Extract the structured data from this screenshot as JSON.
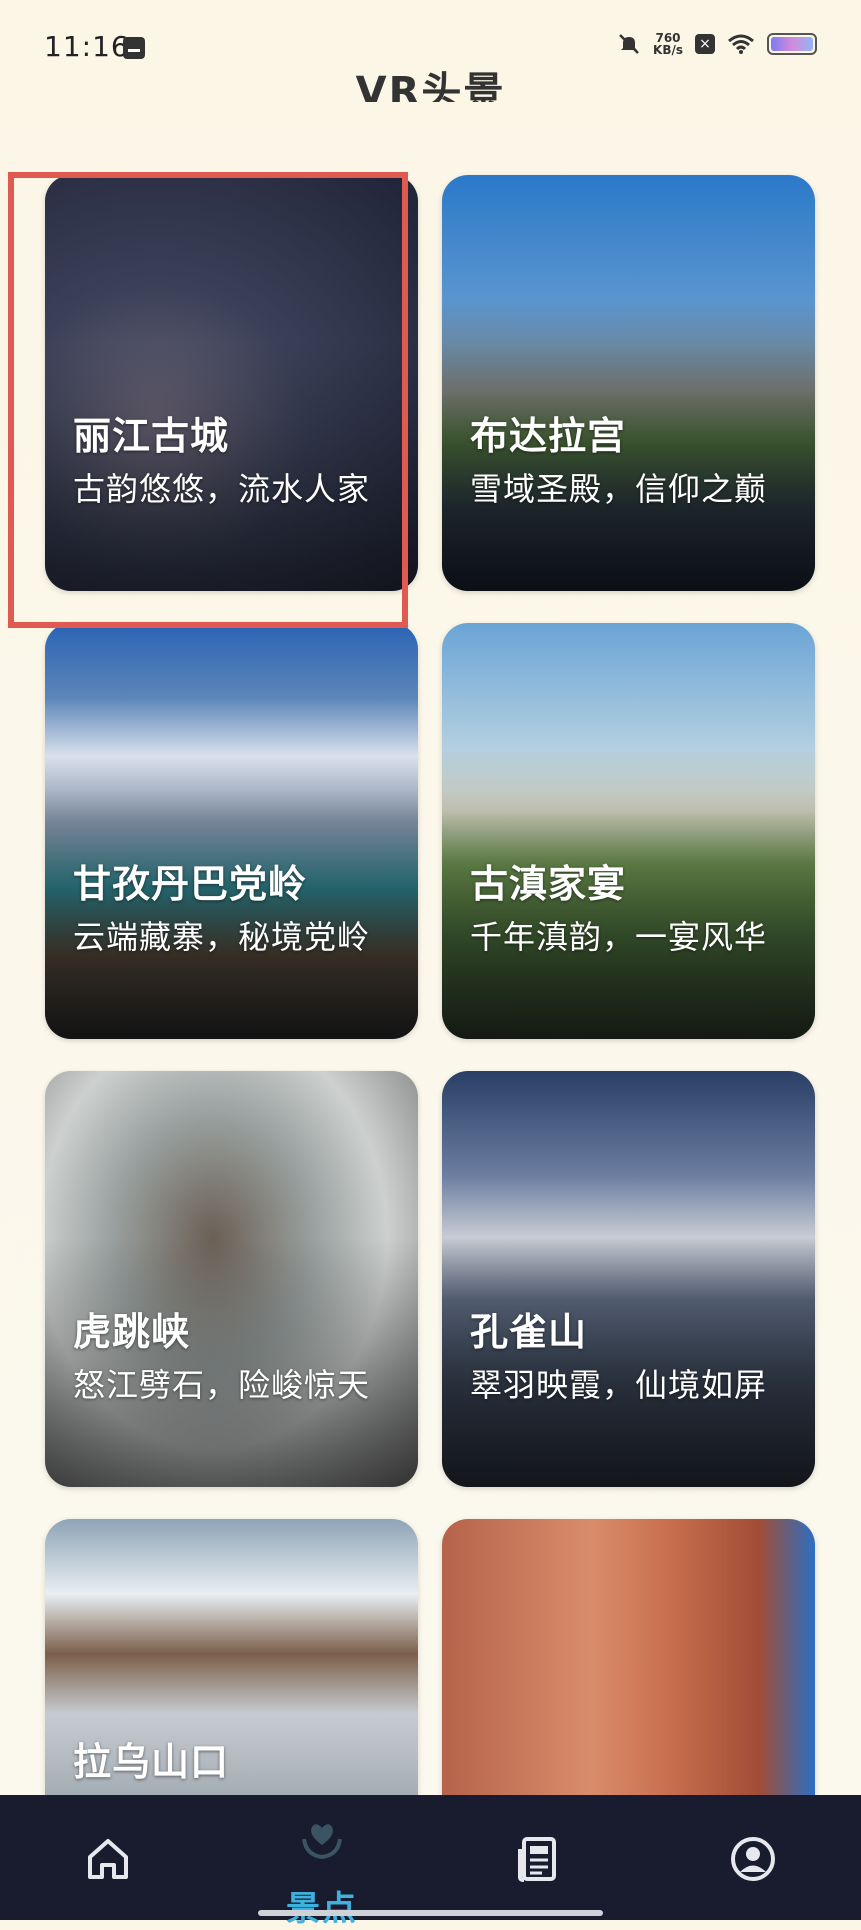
{
  "status_bar": {
    "time": "11:16",
    "net_speed_value": "760",
    "net_speed_unit": "KB/s"
  },
  "app": {
    "title": "VR头景"
  },
  "cards": [
    {
      "title": "丽江古城",
      "desc": "古韵悠悠，流水人家"
    },
    {
      "title": "布达拉宫",
      "desc": "雪域圣殿，信仰之巅"
    },
    {
      "title": "甘孜丹巴党岭",
      "desc": "云端藏寨，秘境党岭"
    },
    {
      "title": "古滇家宴",
      "desc": "千年滇韵，一宴风华"
    },
    {
      "title": "虎跳峡",
      "desc": "怒江劈石，险峻惊天"
    },
    {
      "title": "孔雀山",
      "desc": "翠羽映霞，仙境如屏"
    },
    {
      "title": "拉乌山口",
      "desc": ""
    },
    {
      "title": "",
      "desc": ""
    }
  ],
  "nav": {
    "active_label": "景点",
    "items": [
      "home-icon",
      "spots-icon",
      "news-icon",
      "profile-icon"
    ],
    "active_color": "#3fb1de"
  }
}
